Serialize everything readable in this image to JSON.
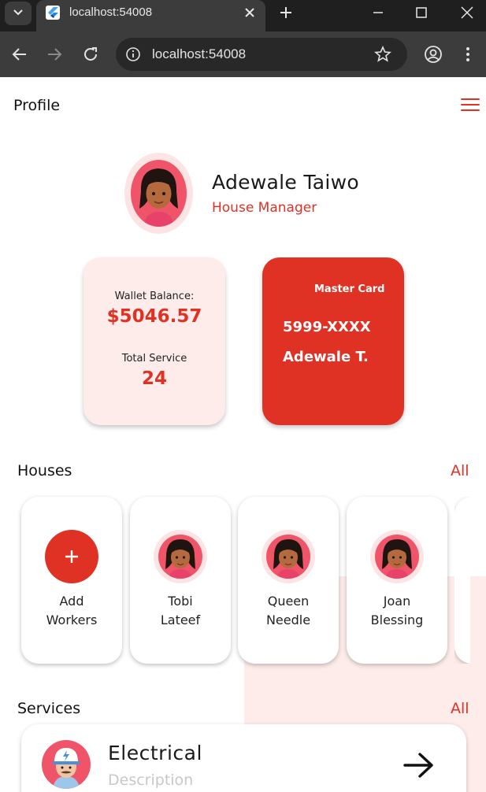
{
  "browser": {
    "tab_title": "localhost:54008",
    "url": "localhost:54008"
  },
  "app": {
    "page_title": "Profile",
    "colors": {
      "accent": "#e03224",
      "pink": "#fdecea",
      "avatar_bg": "#f05468"
    },
    "user": {
      "name": "Adewale Taiwo",
      "role": "House Manager"
    },
    "wallet": {
      "balance_label": "Wallet Balance:",
      "balance_value": "$5046.57",
      "service_label": "Total Service",
      "service_value": "24"
    },
    "card": {
      "title": "Master Card",
      "number": "5999-XXXX",
      "holder": "Adewale T."
    },
    "houses": {
      "title": "Houses",
      "all_label": "All",
      "items": [
        {
          "line1": "Add",
          "line2": "Workers",
          "icon": "plus-icon"
        },
        {
          "line1": "Tobi",
          "line2": "Lateef",
          "icon": "avatar"
        },
        {
          "line1": "Queen",
          "line2": "Needle",
          "icon": "avatar"
        },
        {
          "line1": "Joan",
          "line2": "Blessing",
          "icon": "avatar"
        }
      ]
    },
    "services": {
      "title": "Services",
      "all_label": "All",
      "items": [
        {
          "name": "Electrical",
          "description": "Description",
          "icon": "electrician-avatar"
        }
      ]
    }
  }
}
